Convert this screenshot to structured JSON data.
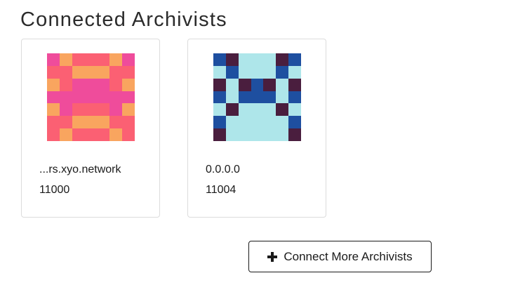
{
  "page_title": "Connected Archivists",
  "archivists": [
    {
      "host": "...rs.xyo.network",
      "port": "11000",
      "identicon_icon": "identicon-pink-orange",
      "identicon_colors": {
        "a": "#fb6073",
        "b": "#ef4c9b",
        "c": "#f9a55f"
      },
      "identicon_grid": [
        "bcaaacb",
        "aacccaa",
        "cabbbac",
        "bbbbbbb",
        "cbaaabc",
        "aacccaa",
        "acaaaca"
      ]
    },
    {
      "host": "0.0.0.0",
      "port": "11004",
      "identicon_icon": "identicon-blue-cyan",
      "identicon_colors": {
        "a": "#1e4fa0",
        "b": "#aee6ea",
        "c": "#4a1e3e"
      },
      "identicon_grid": [
        "acbbbca",
        "babbbab",
        "cbcacbc",
        "abaaaba",
        "bcbbbcb",
        "abbbbba",
        "cbbbbbc"
      ]
    }
  ],
  "connect_button": {
    "label": "Connect More Archivists",
    "icon": "plus-icon"
  }
}
